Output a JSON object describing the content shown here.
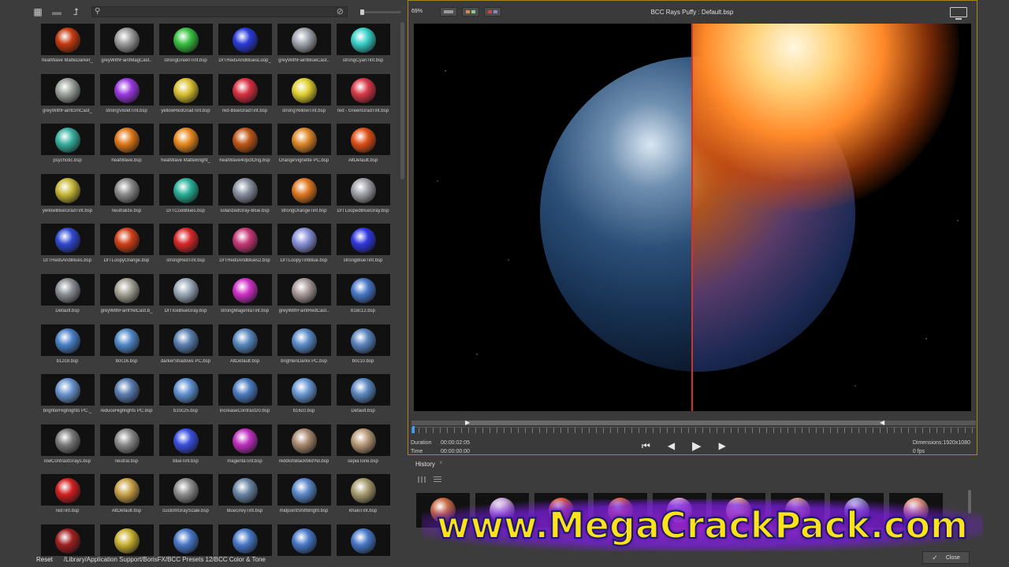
{
  "left_panel": {
    "search": {
      "value": "",
      "placeholder": ""
    },
    "presets": [
      {
        "label": "heatWave MatteDarker_",
        "color": "#c43a10"
      },
      {
        "label": "greyWithFaintMagCast..",
        "color": "#9a9a9a"
      },
      {
        "label": "strongGreenTint.bsp",
        "color": "#38c040"
      },
      {
        "label": "DrTRedsAndBluesLoop_",
        "color": "#2a3ad8"
      },
      {
        "label": "greyWithFaintBlueCast..",
        "color": "#a0a4ae"
      },
      {
        "label": "strongCyanTint.bsp",
        "color": "#38d0c8"
      },
      {
        "label": "greyWithFaintGrnCast_",
        "color": "#9aa09a"
      },
      {
        "label": "strongVioletTint.bsp",
        "color": "#9a38e0"
      },
      {
        "label": "yellowRedGradTint.bsp",
        "color": "#d8c030"
      },
      {
        "label": "red-BlueGradTint.bsp",
        "color": "#d83040"
      },
      {
        "label": "strongYellowTint.bsp",
        "color": "#e0d030"
      },
      {
        "label": "red - GreenGradTint.bsp",
        "color": "#d83848"
      },
      {
        "label": "psychotic.bsp",
        "color": "#38b0a0"
      },
      {
        "label": "heatWave.bsp",
        "color": "#e07818"
      },
      {
        "label": "heatWave MatteBright_",
        "color": "#e88a20"
      },
      {
        "label": "heatWave40pctOrig.bsp",
        "color": "#c05818"
      },
      {
        "label": "OrangeVignette PC.bsp",
        "color": "#e08828"
      },
      {
        "label": "AltDefault.bsp",
        "color": "#e05018"
      },
      {
        "label": "yellowBlueGradTint.bsp",
        "color": "#c8b838"
      },
      {
        "label": "neutralize.bsp",
        "color": "#8a8a8a"
      },
      {
        "label": "DrTCoolBlues.bsp",
        "color": "#28b098"
      },
      {
        "label": "solarizedGray-Blue.bsp",
        "color": "#8890a0"
      },
      {
        "label": "strongOrangeTint.bsp",
        "color": "#e07820"
      },
      {
        "label": "DrTLoopedBlueGray.bsp",
        "color": "#a0a0a8"
      },
      {
        "label": "DrTRedsAndBlues.bsp",
        "color": "#3048d0"
      },
      {
        "label": "DrTLoopyOrange.bsp",
        "color": "#d04018"
      },
      {
        "label": "strongRedTint.bsp",
        "color": "#d82828"
      },
      {
        "label": "DrTRedsAndBlues2.bsp",
        "color": "#c83878"
      },
      {
        "label": "DrTLoopyTintBlue.bsp",
        "color": "#8890d8"
      },
      {
        "label": "strongBlueTint.bsp",
        "color": "#3038e0"
      },
      {
        "label": "Default.bsp",
        "color": "#8a8e94"
      },
      {
        "label": "greyWithFaintYelCast.b_",
        "color": "#a4a294"
      },
      {
        "label": "DrTIceBlueGray.bsp",
        "color": "#9aa8b8"
      },
      {
        "label": "strongMagentaTint.bsp",
        "color": "#d030c8"
      },
      {
        "label": "greyWithFaintRedCast..",
        "color": "#a89a9a"
      },
      {
        "label": "b18c12.bsp",
        "color": "#4878c8"
      },
      {
        "label": "b12c8.bsp",
        "color": "#4a80c8"
      },
      {
        "label": "b0c16.bsp",
        "color": "#5088c8"
      },
      {
        "label": "darkerShadows PC.bsp",
        "color": "#5a7fb0"
      },
      {
        "label": "AltDefault.bsp",
        "color": "#5888c0"
      },
      {
        "label": "brightenDarkx PC.bsp",
        "color": "#5a8cc8"
      },
      {
        "label": "b0c10.bsp",
        "color": "#5a84c0"
      },
      {
        "label": "brighterHighlights PC._",
        "color": "#6a94d0"
      },
      {
        "label": "reduceHighlights PC.bsp",
        "color": "#5a7cb0"
      },
      {
        "label": "b10c25.bsp",
        "color": "#6090d0"
      },
      {
        "label": "increaseContrast20.bsp",
        "color": "#4c7cc0"
      },
      {
        "label": "b16c0.bsp",
        "color": "#6898d4"
      },
      {
        "label": "Default.bsp",
        "color": "#5a88c0"
      },
      {
        "label": "lowContrastGrays.bsp",
        "color": "#7a7a7a"
      },
      {
        "label": "neutral.bsp",
        "color": "#8a8a8a"
      },
      {
        "label": "blueTint.bsp",
        "color": "#3a50e0"
      },
      {
        "label": "magentaTint.bsp",
        "color": "#c030c0"
      },
      {
        "label": "reddishBlackMidYel.bsp",
        "color": "#a88a70"
      },
      {
        "label": "sepiaTone.bsp",
        "color": "#b89a78"
      },
      {
        "label": "redTint.bsp",
        "color": "#d02020"
      },
      {
        "label": "AltDefault.bsp",
        "color": "#c8a048"
      },
      {
        "label": "customGrayScale.bsp",
        "color": "#8c8c8c"
      },
      {
        "label": "blueGreyTint.bsp",
        "color": "#6a86a4"
      },
      {
        "label": "midpointShiftBright.bsp",
        "color": "#5a88c8"
      },
      {
        "label": "khakiTint.bsp",
        "color": "#a89c70"
      },
      {
        "label": "",
        "color": "#a02020"
      },
      {
        "label": "",
        "color": "#c8b030"
      },
      {
        "label": "",
        "color": "#4878c8"
      },
      {
        "label": "",
        "color": "#4878c8"
      },
      {
        "label": "",
        "color": "#4878c8"
      },
      {
        "label": "",
        "color": "#4878c8"
      }
    ],
    "reset_label": "Reset",
    "path": "/Library/Application Support/BorisFX/BCC Presets 12/BCC Color & Tone"
  },
  "preview": {
    "zoom": "69%",
    "title": "BCC Rays Puffy : Default.bsp",
    "duration_label": "Duration",
    "duration_value": "00:00:02:05",
    "time_label": "Time",
    "time_value": "00:00:00:00",
    "dimensions": "Dimensions:1920x1080",
    "fps": "0 fps",
    "split_color": "#d3322a"
  },
  "history": {
    "tab_label": "History",
    "close_glyph": "x",
    "thumbs": [
      {
        "color": "#c86a48"
      },
      {
        "color": "#c8a8d8"
      },
      {
        "color": "#d86048"
      },
      {
        "color": "#d86a50"
      },
      {
        "color": "#d8a0d0"
      },
      {
        "color": "#e8b080"
      },
      {
        "color": "#c89890"
      },
      {
        "color": "#9898c8"
      },
      {
        "color": "#d89080"
      }
    ]
  },
  "watermark": "www.MegaCrackPack.com",
  "close_label": "Close",
  "accent_color": "#a88722"
}
